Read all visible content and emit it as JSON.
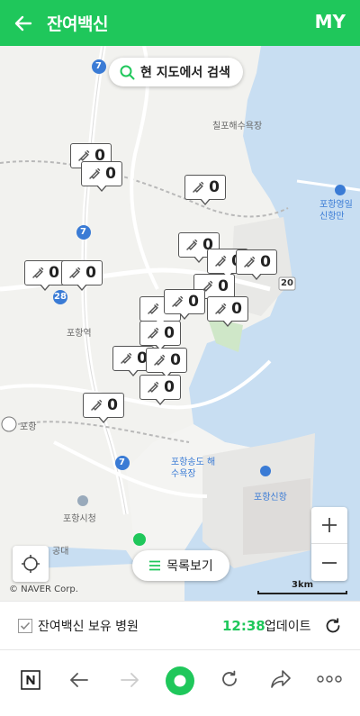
{
  "header": {
    "title": "잔여백신",
    "my_label": "MY",
    "back_icon": "arrow-left-icon",
    "bg_color": "#1fc75b"
  },
  "map": {
    "search_label": "현 지도에서 검색",
    "list_label": "목록보기",
    "copyright": "© NAVER Corp.",
    "scale": "3km",
    "markers": [
      "0",
      "0",
      "0",
      "0",
      "0",
      "0",
      "0",
      "0",
      "0",
      "0",
      "0",
      "0",
      "0",
      "0",
      "0",
      "0",
      "0"
    ],
    "labels": {
      "chilpo": "칠포해수욕장",
      "yeongil": "포항영일 신항만",
      "pohang_station": "포항역",
      "pohang": "포항",
      "songdo": "포항송도 해수욕장",
      "sinhang": "포항신항",
      "city_hall": "포항시청",
      "gongdae": "공대",
      "road_7a": "7",
      "road_7b": "7",
      "road_7c": "7",
      "road_20": "20",
      "road_28": "28"
    }
  },
  "status": {
    "label": "잔여백신 보유 병원",
    "time": "12:38",
    "update_label": "업데이트"
  },
  "browser": {
    "icons": [
      "naver-n-icon",
      "back-arrow-icon",
      "forward-arrow-icon",
      "home-circle-icon",
      "reload-icon",
      "share-icon",
      "more-icon"
    ],
    "accent": "#1fc75b"
  }
}
